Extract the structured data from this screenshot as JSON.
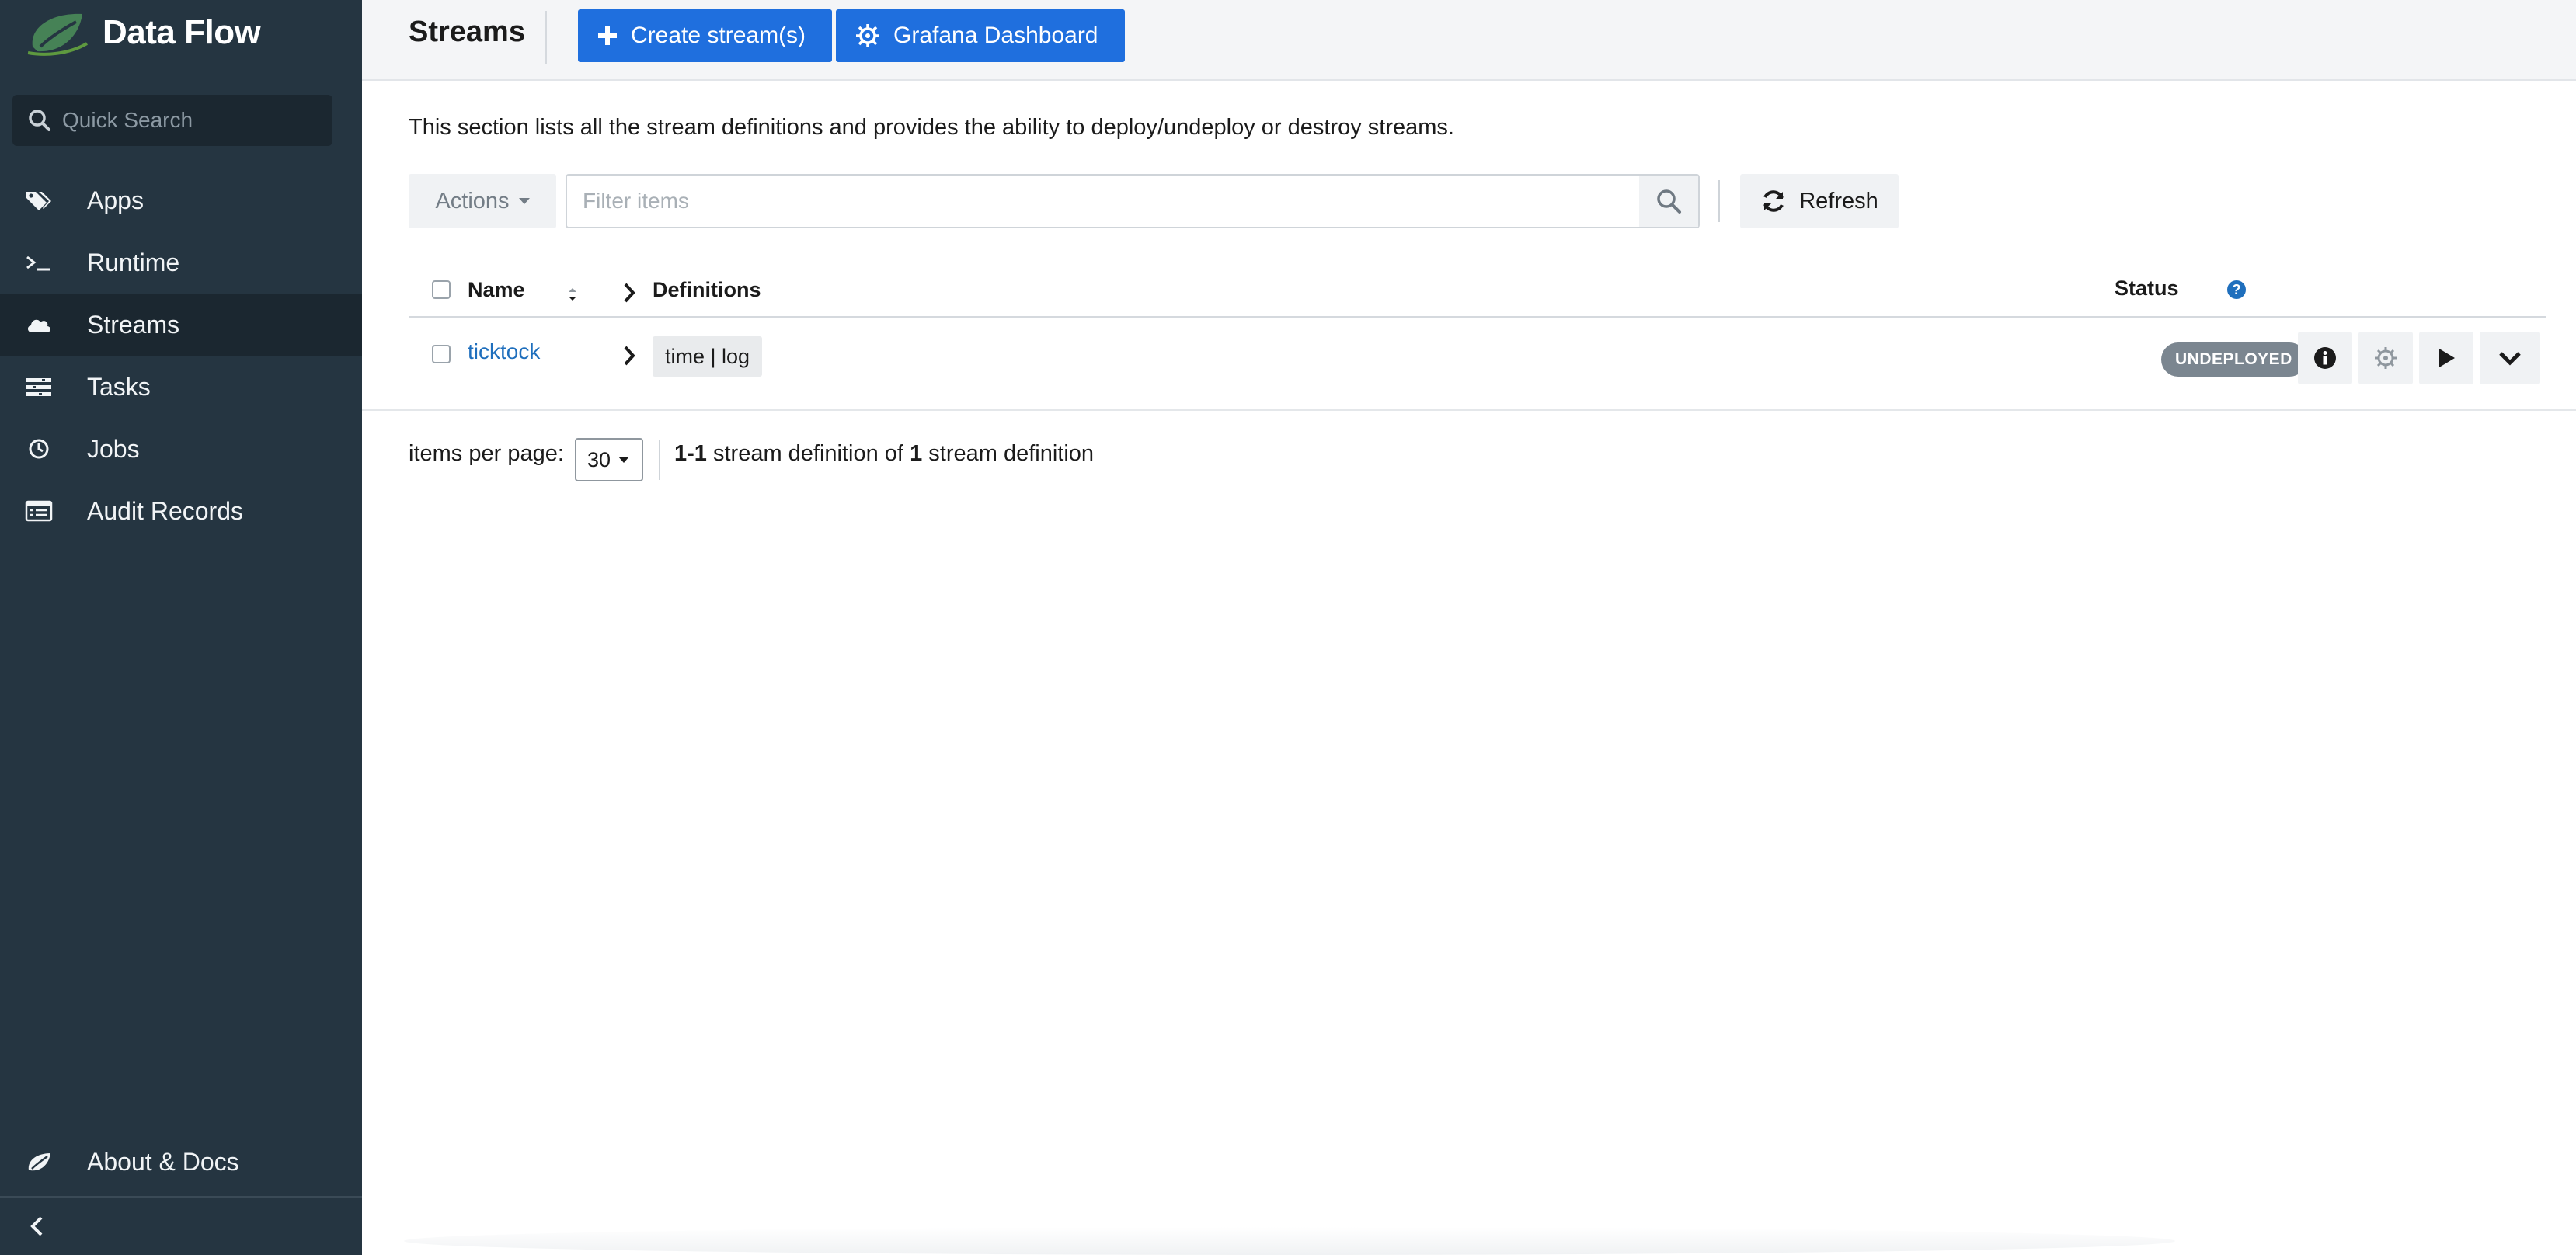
{
  "app": {
    "title": "Data Flow"
  },
  "sidebar": {
    "search_placeholder": "Quick Search",
    "items": [
      {
        "label": "Apps",
        "icon": "tags-icon",
        "active": false
      },
      {
        "label": "Runtime",
        "icon": "terminal-icon",
        "active": false
      },
      {
        "label": "Streams",
        "icon": "cloud-icon",
        "active": true
      },
      {
        "label": "Tasks",
        "icon": "tasks-icon",
        "active": false
      },
      {
        "label": "Jobs",
        "icon": "clock-icon",
        "active": false
      },
      {
        "label": "Audit Records",
        "icon": "list-icon",
        "active": false
      }
    ],
    "about_label": "About & Docs"
  },
  "header": {
    "title": "Streams",
    "create_label": "Create stream(s)",
    "grafana_label": "Grafana Dashboard"
  },
  "main": {
    "description": "This section lists all the stream definitions and provides the ability to deploy/undeploy or destroy streams.",
    "actions_label": "Actions",
    "filter_placeholder": "Filter items",
    "refresh_label": "Refresh",
    "columns": {
      "name": "Name",
      "definitions": "Definitions",
      "status": "Status"
    },
    "rows": [
      {
        "name": "ticktock",
        "definition": "time | log",
        "status": "UNDEPLOYED"
      }
    ],
    "pagination": {
      "label": "items per page:",
      "per_page": "30",
      "range": "1-1",
      "mid_text": " stream definition of ",
      "total": "1",
      "suffix": " stream definition"
    }
  },
  "colors": {
    "sidebar_bg": "#253541",
    "primary": "#1f6fde",
    "link": "#1f6fbd",
    "badge": "#7b8690",
    "logo_green": "#6db33f"
  }
}
